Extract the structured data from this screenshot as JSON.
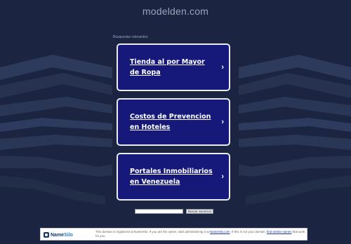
{
  "header": {
    "domain": "modelden.com"
  },
  "related": {
    "label": "Búsquedas relevantes",
    "links": [
      {
        "label": "Tienda al por Mayor de Ropa",
        "chevron": "›"
      },
      {
        "label": "Costos de Prevencion en Hoteles",
        "chevron": "›"
      },
      {
        "label": "Portales Inmobiliarios en Venezuela",
        "chevron": "›"
      }
    ]
  },
  "search": {
    "placeholder": "",
    "button_label": "Buscar anuncios"
  },
  "notice": {
    "brand_part1": "Name",
    "brand_part2": "Silo",
    "text1": "This domain is registered at NameSilo. If you are the owner, start administering it at ",
    "link1": "NameSilo.com",
    "text2": ". If this is not your domain, ",
    "link2": "find similar names",
    "text3": " that work for you."
  },
  "colors": {
    "background": "#1b2440",
    "card": "#17197a",
    "card_border": "#e9ecf3"
  }
}
